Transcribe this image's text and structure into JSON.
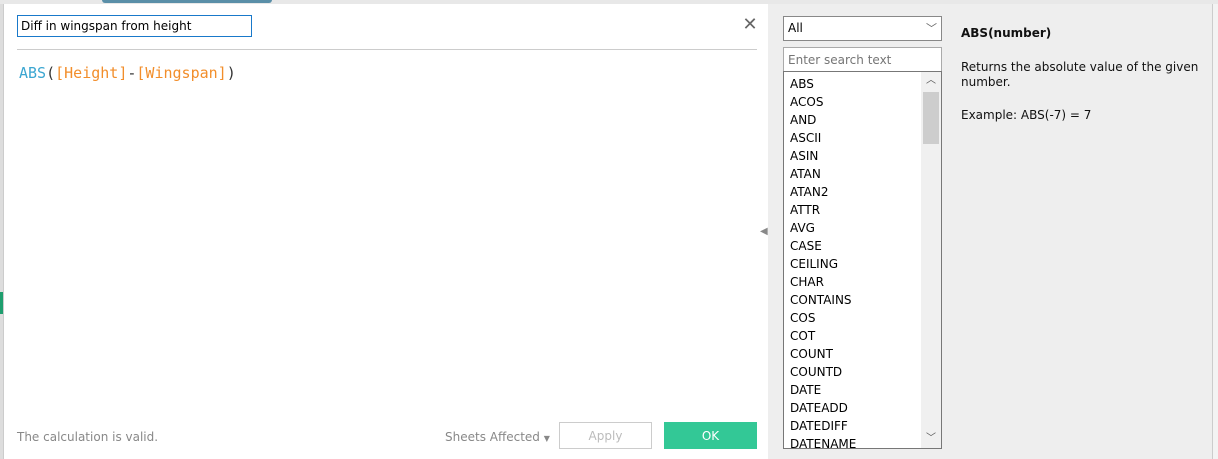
{
  "calc_name": "Diff in wingspan from height",
  "formula": {
    "fn": "ABS",
    "open": "(",
    "field1": "[Height]",
    "op": "-",
    "field2": "[Wingspan]",
    "close": ")"
  },
  "close_icon": "✕",
  "status": "The calculation is valid.",
  "sheets_affected": "Sheets Affected",
  "apply_label": "Apply",
  "ok_label": "OK",
  "category_select": "All",
  "search_placeholder": "Enter search text",
  "functions": [
    "ABS",
    "ACOS",
    "AND",
    "ASCII",
    "ASIN",
    "ATAN",
    "ATAN2",
    "ATTR",
    "AVG",
    "CASE",
    "CEILING",
    "CHAR",
    "CONTAINS",
    "COS",
    "COT",
    "COUNT",
    "COUNTD",
    "DATE",
    "DATEADD",
    "DATEDIFF",
    "DATENAME"
  ],
  "help": {
    "title": "ABS(number)",
    "body": "Returns the absolute value of the given number.",
    "example": "Example: ABS(-7) = 7"
  },
  "colors": {
    "ok": "#33c896",
    "function": "#3ba6d1",
    "field": "#f28e2b"
  }
}
